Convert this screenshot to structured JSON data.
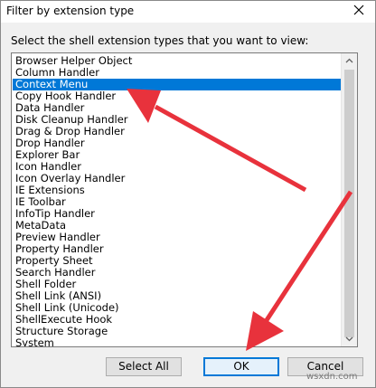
{
  "window": {
    "title": "Filter by extension type"
  },
  "instructions": "Select the shell extension types that you want to view:",
  "list": {
    "selected_index": 2,
    "items": [
      "Browser Helper Object",
      "Column Handler",
      "Context Menu",
      "Copy Hook Handler",
      "Data Handler",
      "Disk Cleanup Handler",
      "Drag & Drop Handler",
      "Drop Handler",
      "Explorer Bar",
      "Icon Handler",
      "Icon Overlay Handler",
      "IE Extensions",
      "IE Toolbar",
      "InfoTip Handler",
      "MetaData",
      "Preview Handler",
      "Property Handler",
      "Property Sheet",
      "Search Handler",
      "Shell Folder",
      "Shell Link (ANSI)",
      "Shell Link (Unicode)",
      "ShellExecute Hook",
      "Structure Storage",
      "System"
    ]
  },
  "buttons": {
    "select_all": "Select All",
    "ok": "OK",
    "cancel": "Cancel"
  },
  "watermark": "wsxdn.com",
  "colors": {
    "selection": "#0078d7",
    "annotation_arrow": "#e8323c"
  }
}
